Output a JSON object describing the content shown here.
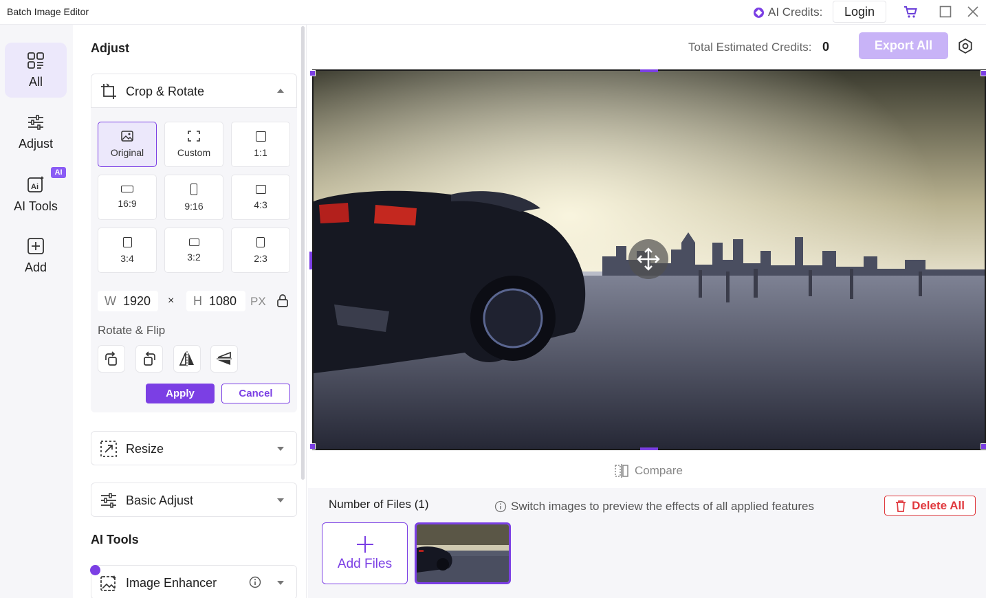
{
  "window": {
    "title": "Batch Image Editor"
  },
  "header": {
    "ai_credits_label": "AI Credits:",
    "login_label": "Login"
  },
  "rail": {
    "items": [
      {
        "label": "All",
        "icon": "grid-icon",
        "active": true
      },
      {
        "label": "Adjust",
        "icon": "sliders-icon",
        "active": false
      },
      {
        "label": "AI Tools",
        "icon": "ai-tools-icon",
        "active": false,
        "badge": "AI"
      },
      {
        "label": "Add",
        "icon": "add-icon",
        "active": false
      }
    ]
  },
  "panel": {
    "adjust_heading": "Adjust",
    "crop": {
      "title": "Crop & Rotate",
      "expanded": true,
      "ratios": [
        {
          "label": "Original",
          "selected": true
        },
        {
          "label": "Custom",
          "selected": false
        },
        {
          "label": "1:1",
          "selected": false
        },
        {
          "label": "16:9",
          "selected": false
        },
        {
          "label": "9:16",
          "selected": false
        },
        {
          "label": "4:3",
          "selected": false
        },
        {
          "label": "3:4",
          "selected": false
        },
        {
          "label": "3:2",
          "selected": false
        },
        {
          "label": "2:3",
          "selected": false
        }
      ],
      "width_key": "W",
      "width_value": "1920",
      "times": "×",
      "height_key": "H",
      "height_value": "1080",
      "unit": "PX",
      "rotate_flip_label": "Rotate & Flip",
      "apply_label": "Apply",
      "cancel_label": "Cancel"
    },
    "resize_label": "Resize",
    "basic_adjust_label": "Basic Adjust",
    "ai_tools_heading": "AI Tools",
    "image_enhancer_label": "Image Enhancer"
  },
  "main": {
    "total_credits_label": "Total Estimated Credits:",
    "total_credits_value": "0",
    "export_label": "Export All",
    "compare_label": "Compare",
    "files_count_label": "Number of Files (1)",
    "hint": "Switch images to preview the effects of all applied features",
    "delete_label": "Delete All",
    "add_files_label": "Add Files"
  },
  "colors": {
    "accent": "#7b3fe4",
    "accent_light": "#ece8fb",
    "danger": "#e0393e",
    "export_disabled": "#c8b3f7"
  }
}
